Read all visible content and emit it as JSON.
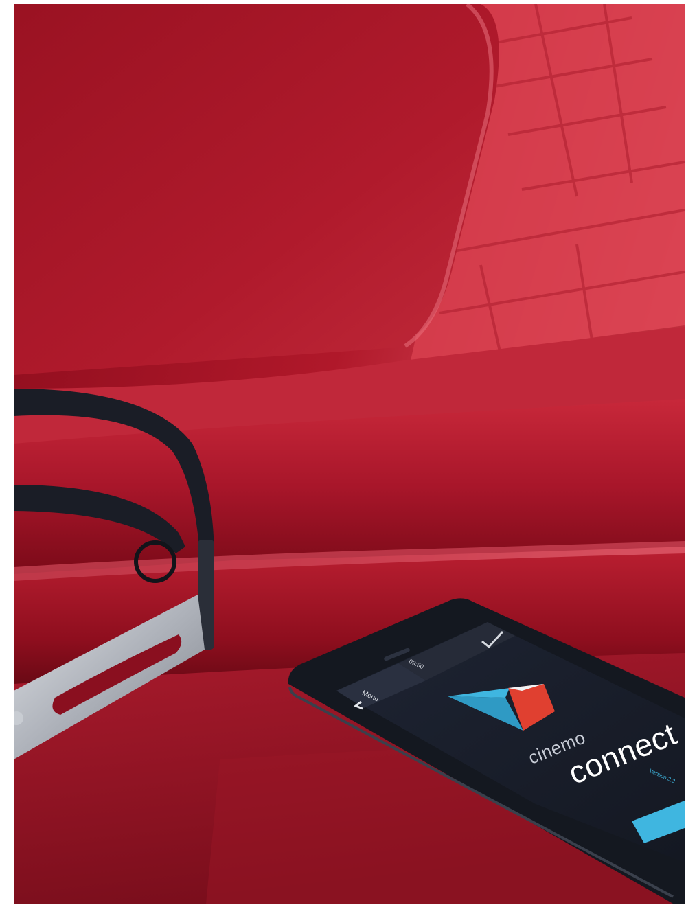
{
  "photo": {
    "subject": "headphones-and-smartphone-on-red-cinema-seats",
    "colors": {
      "seat_red": "#b0182a",
      "seat_red_light": "#e0485a",
      "seat_red_dark": "#5e0812",
      "phone_body": "#141820",
      "screen_bg": "#1c2230",
      "accent_blue": "#3fb6e0",
      "accent_red": "#e04030",
      "metal": "#b4b8c0"
    }
  },
  "phone_screen": {
    "status_time": "09:50",
    "back_label": "Menu",
    "brand_small": "cinemo",
    "brand_large": "connect",
    "version": "Version 3.3"
  }
}
